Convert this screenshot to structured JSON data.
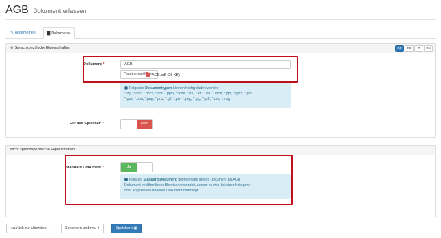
{
  "header": {
    "title": "AGB",
    "subtitle": "Dokument erfassen"
  },
  "tabs": [
    {
      "label": "Allgemeines",
      "icon": "pencil-icon",
      "active": false
    },
    {
      "label": "Dokumente",
      "icon": "document-icon",
      "active": true
    }
  ],
  "section_language": {
    "heading": "Sprachspezifische Eigenschaften",
    "heading_icon": "globe-icon",
    "languages": [
      "DE",
      "FR",
      "IT",
      "EN"
    ],
    "active_language": "DE",
    "document_label": "Dokument",
    "required_mark": "*",
    "document_value": "AGB",
    "file_button": "Datei auswählen...",
    "file_name": "AGB.pdf (28 KB)",
    "file_icon": "pdf-file-icon",
    "info_prefix": "Folgende ",
    "info_bold": "Dokumenttypen",
    "info_suffix": " können hochgeladen werden:",
    "info_types_line1": "*.zip, *.doc, *.docx, *.dot, *.ppsx, *.xlsx, *.xls, *.xlt, *.xla, *.xlsm, *.ppt, *.pptx, *.pot,",
    "info_types_line2": "*.pps, *.ppa, *.png, *.pnz, *.gif, *.jpe, *.jpeg, *.jpg, *.pdf, *.csv, *.msg",
    "all_languages_label": "Für alle Sprachen",
    "all_languages_toggle": "Nein"
  },
  "section_general": {
    "heading": "Nicht sprachspezifische Eigenschaften",
    "default_doc_label": "Standard Dokument",
    "required_mark": "*",
    "toggle_value": "Ja",
    "info_prefix": "Falls als ",
    "info_bold": "Standard Dokument",
    "info_line1_rest": " definiert wird dieses Dokument als AGB",
    "info_line2": "Dokument im öffentlichen Bereich verwendet, ausser es wird bei einer Kategorie",
    "info_line3": "oder Angebot ein anderes Dokument hinterlegt."
  },
  "footer": {
    "back_label": "zurück zur Übersicht",
    "save_new_label": "Speichern und neu",
    "save_label": "Speichern"
  },
  "colors": {
    "primary": "#337ab7",
    "danger": "#d9534f",
    "success": "#5cb85c",
    "info_bg": "#d9edf7",
    "highlight": "#c0101c"
  }
}
